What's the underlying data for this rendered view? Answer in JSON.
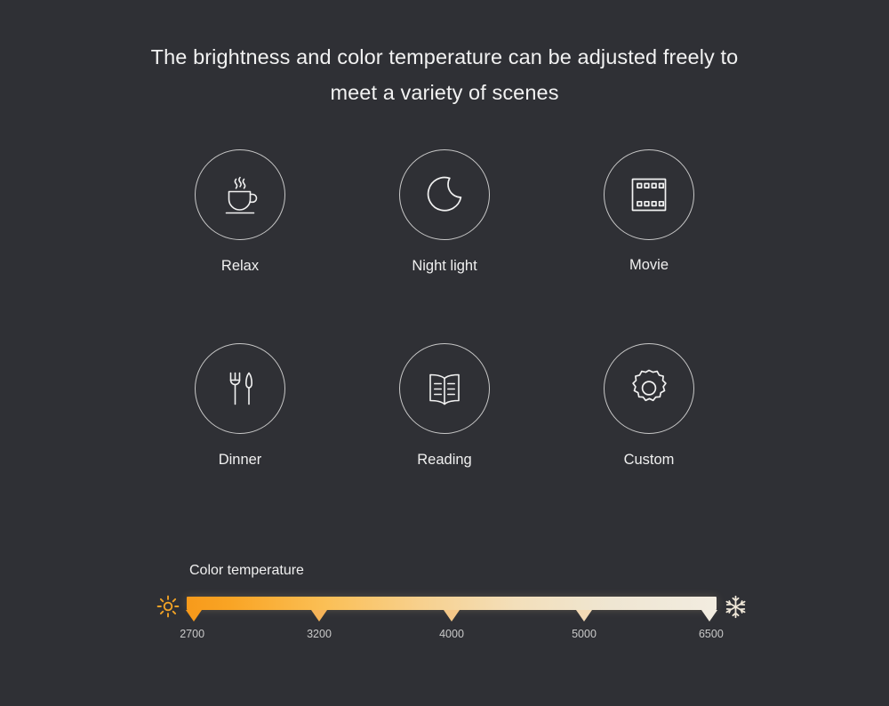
{
  "heading": {
    "line1": "The brightness and color temperature can be adjusted freely to",
    "line2": "meet a variety of scenes"
  },
  "scenes": {
    "row1": [
      {
        "label": "Relax",
        "icon": "coffee-cup-icon"
      },
      {
        "label": "Night light",
        "icon": "crescent-moon-icon"
      },
      {
        "label": "Movie",
        "icon": "film-strip-icon"
      }
    ],
    "row2": [
      {
        "label": "Dinner",
        "icon": "fork-and-knife-icon"
      },
      {
        "label": "Reading",
        "icon": "open-book-icon"
      },
      {
        "label": "Custom",
        "icon": "gear-icon"
      }
    ]
  },
  "color_temperature": {
    "title": "Color temperature",
    "warm_icon": "sun-icon",
    "cool_icon": "snowflake-icon",
    "ticks": [
      {
        "value": "2700",
        "position_pct": 0
      },
      {
        "value": "3200",
        "position_pct": 25
      },
      {
        "value": "4000",
        "position_pct": 50
      },
      {
        "value": "5000",
        "position_pct": 75
      },
      {
        "value": "6500",
        "position_pct": 100
      }
    ],
    "colors": {
      "warm_end": "#f79a1b",
      "cool_end": "#f2ece0",
      "sun_icon": "#f0a226",
      "snowflake_icon": "#efe7d8",
      "background": "#2f3035",
      "text": "#f0f0f0",
      "tick_text": "#c9c9c9",
      "circle_stroke": "#c8c8c8"
    }
  }
}
